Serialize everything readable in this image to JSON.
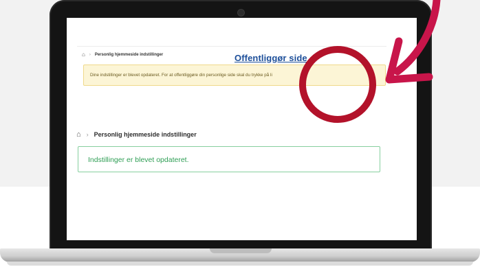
{
  "colors": {
    "annotation_red": "#b3122a",
    "arrow_pink": "#c8154a",
    "link_blue": "#1d4f9a",
    "success_green": "#2f9e55",
    "notice_yellow": "#fcf5d6"
  },
  "icons": {
    "home": "⌂",
    "chevron": "›"
  },
  "top_breadcrumb": {
    "label": "Personlig hjemmeside indstillinger"
  },
  "notice": {
    "text": "Dine indstillinger er blevet opdateret. For at offentliggøre din personlige side skal du trykke på li",
    "link_label": "Offentliggør side"
  },
  "breadcrumb": {
    "label": "Personlig hjemmeside indstillinger"
  },
  "success": {
    "message": "Indstillinger er blevet opdateret."
  }
}
